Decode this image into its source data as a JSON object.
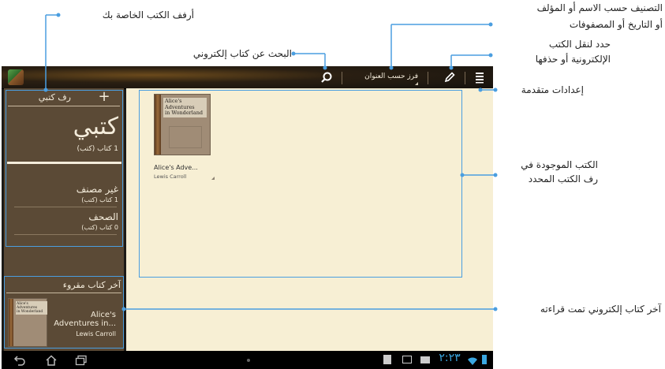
{
  "topbar": {
    "sort_label": "فرز حسب العنوان",
    "search_icon": "search-icon",
    "edit_icon": "pencil-icon",
    "menu_icon": "menu-icon"
  },
  "sidebar": {
    "shelf_header": "رف كتبي",
    "add_symbol": "+",
    "my_books_title": "كتبي",
    "my_books_count": "1 كتاب (كتب)",
    "items": [
      {
        "label": "غير مصنف",
        "count": "1 كتاب (كتب)"
      },
      {
        "label": "الصحف",
        "count": "0 كتاب (كتب)"
      }
    ],
    "recent_header": "آخر كتاب مقروء",
    "recent_title_line1": "Alice's",
    "recent_title_line2": "Adventures in...",
    "recent_author": "Lewis Carroll",
    "recent_cover_text": [
      "Alice's",
      "Adventures",
      "in Wonderland"
    ]
  },
  "book": {
    "cover_text": [
      "Alice's",
      "Adventures",
      "in Wonderland"
    ],
    "title": "Alice's Adve...",
    "author": "Lewis Carroll"
  },
  "status": {
    "time": "٢:٢٣"
  },
  "callouts": {
    "shelves": "أرفف الكتب الخاصة بك",
    "search": "البحث عن كتاب إلكتروني",
    "sort_line1": "التصنيف حسب الاسم أو المؤلف",
    "sort_line2": "أو التاريخ أو المصفوفات",
    "move_line1": "حدد لنقل الكتب",
    "move_line2": "الإلكترونية أو حذفها",
    "advanced": "إعدادات متقدمة",
    "books_line1": "الكتب الموجودة في",
    "books_line2": "رف الكتب المحدد",
    "last_read": "آخر كتاب إلكتروني تمت قراءته"
  }
}
